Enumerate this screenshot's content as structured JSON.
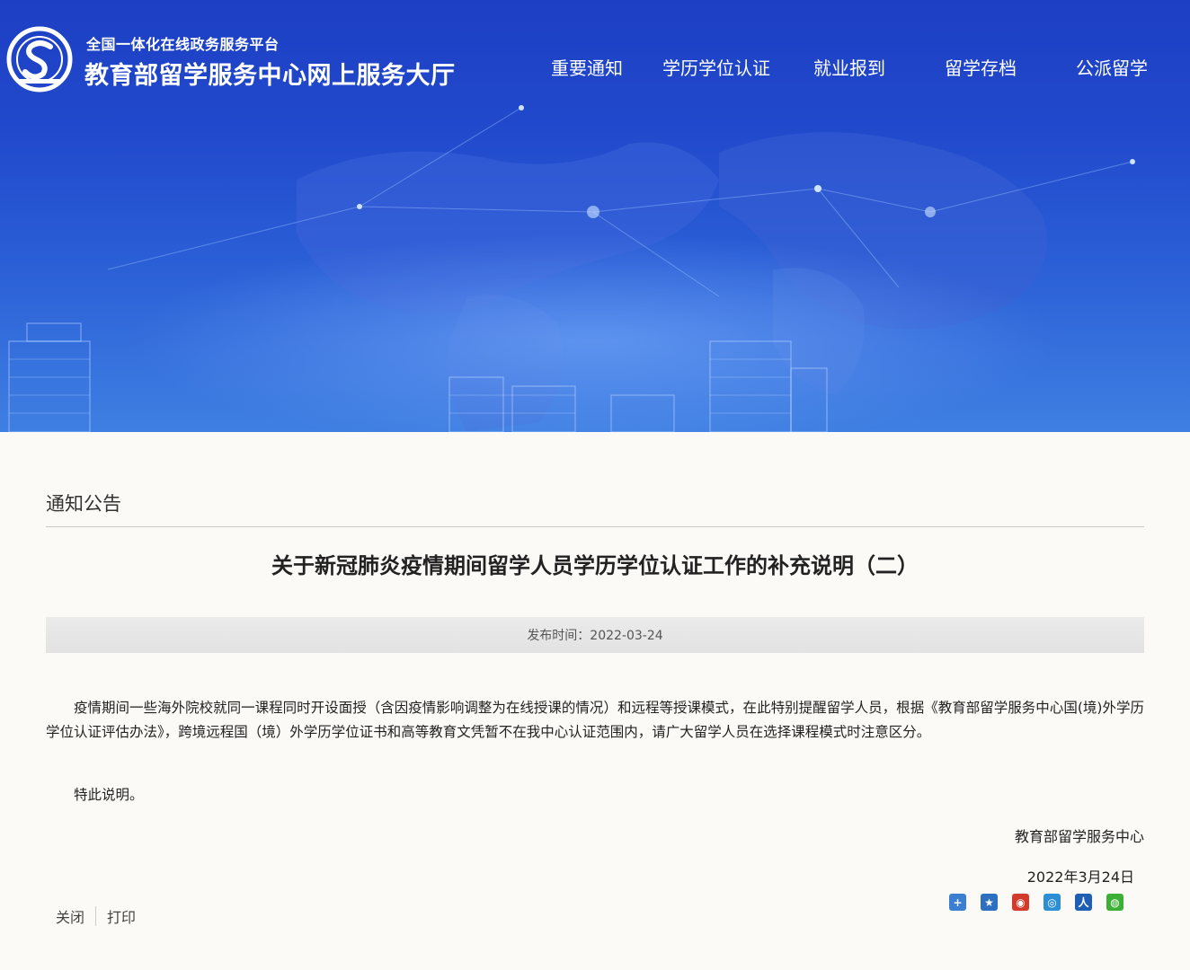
{
  "header": {
    "subtitle": "全国一体化在线政务服务平台",
    "title": "教育部留学服务中心网上服务大厅"
  },
  "nav": {
    "items": [
      {
        "label": "重要通知"
      },
      {
        "label": "学历学位认证"
      },
      {
        "label": "就业报到"
      },
      {
        "label": "留学存档"
      },
      {
        "label": "公派留学"
      }
    ]
  },
  "section": {
    "title": "通知公告"
  },
  "article": {
    "title": "关于新冠肺炎疫情期间留学人员学历学位认证工作的补充说明（二）",
    "publish_label": "发布时间：2022-03-24",
    "paragraph1": "疫情期间一些海外院校就同一课程同时开设面授（含因疫情影响调整为在线授课的情况）和远程等授课模式，在此特别提醒留学人员，根据《教育部留学服务中心国(境)外学历学位认证评估办法》，跨境远程国（境）外学历学位证书和高等教育文凭暂不在我中心认证范围内，请广大留学人员在选择课程模式时注意区分。",
    "paragraph2": "特此说明。",
    "signature": "教育部留学服务中心",
    "date": "2022年3月24日"
  },
  "footer": {
    "close_label": "关闭",
    "print_label": "打印"
  },
  "share_icons": [
    {
      "icon": "plus-share-icon",
      "color": "#3a7fd0",
      "glyph": "+"
    },
    {
      "icon": "qzone-icon",
      "color": "#2d6fc0",
      "glyph": "★"
    },
    {
      "icon": "weibo-icon",
      "color": "#d23a2a",
      "glyph": "◉"
    },
    {
      "icon": "tencent-weibo-icon",
      "color": "#2c8fd6",
      "glyph": "◎"
    },
    {
      "icon": "renren-icon",
      "color": "#1e5fb5",
      "glyph": "人"
    },
    {
      "icon": "wechat-icon",
      "color": "#3cb034",
      "glyph": "◍"
    }
  ]
}
